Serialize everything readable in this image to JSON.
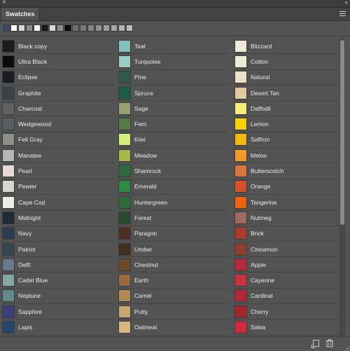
{
  "panel": {
    "tab_label": "Swatches",
    "close_glyph": "×",
    "collapse_glyph": "»"
  },
  "recent_swatches": [
    "#3a4a6a",
    "#ffffff",
    "#d9d9d9",
    "#8c8c8c",
    "#ffffff",
    "#1a1a1a",
    "#d9d9d9",
    "#8c8c8c",
    "#0a0a0a",
    "#6f6f6f",
    "#7a7a7a",
    "#858585",
    "#909090",
    "#9b9b9b",
    "#a6a6a6",
    "#b1b1b1",
    "#bcbcbc"
  ],
  "columns": [
    [
      {
        "name": "Black copy",
        "color": "#1b1b1b"
      },
      {
        "name": "Ultra Black",
        "color": "#0a0a0a"
      },
      {
        "name": "Eclipse",
        "color": "#1a1c20"
      },
      {
        "name": "Graphite",
        "color": "#3b4148"
      },
      {
        "name": "Charcoal",
        "color": "#5e6262"
      },
      {
        "name": "Wedgewood",
        "color": "#545f66"
      },
      {
        "name": "Felt Gray",
        "color": "#8e8e8a"
      },
      {
        "name": "Manatee",
        "color": "#b7b6b9"
      },
      {
        "name": "Pearl",
        "color": "#e6d9d3"
      },
      {
        "name": "Pewter",
        "color": "#d7d6cf"
      },
      {
        "name": "Cape Cod",
        "color": "#eeece3"
      },
      {
        "name": "Midnight",
        "color": "#1d2b36"
      },
      {
        "name": "Navy",
        "color": "#2c3a52"
      },
      {
        "name": "Patriot",
        "color": "#344652"
      },
      {
        "name": "Delft",
        "color": "#687a8a"
      },
      {
        "name": "Cadet Blue",
        "color": "#86a6a4"
      },
      {
        "name": "Neptune",
        "color": "#5e8a8c"
      },
      {
        "name": "Sapphire",
        "color": "#3a3f76"
      },
      {
        "name": "Lapis",
        "color": "#24466a"
      }
    ],
    [
      {
        "name": "Teal",
        "color": "#85bfba"
      },
      {
        "name": "Turquoise",
        "color": "#99cfc4"
      },
      {
        "name": "Pine",
        "color": "#2f5a46"
      },
      {
        "name": "Spruce",
        "color": "#1d5a46"
      },
      {
        "name": "Sage",
        "color": "#96a26f"
      },
      {
        "name": "Fern",
        "color": "#557a46"
      },
      {
        "name": "Kiwi",
        "color": "#d4f07a"
      },
      {
        "name": "Meadow",
        "color": "#a6b64f"
      },
      {
        "name": "Shamrock",
        "color": "#2a6a3e"
      },
      {
        "name": "Emerald",
        "color": "#2e8a3e"
      },
      {
        "name": "Huntergreen",
        "color": "#2f6a3a"
      },
      {
        "name": "Forest",
        "color": "#274a30"
      },
      {
        "name": "Paragon",
        "color": "#4c3026"
      },
      {
        "name": "Umber",
        "color": "#3f2f1e"
      },
      {
        "name": "Chestnut",
        "color": "#6a4a2a"
      },
      {
        "name": "Earth",
        "color": "#9a6a3e"
      },
      {
        "name": "Camel",
        "color": "#b08a54"
      },
      {
        "name": "Putty",
        "color": "#c8a872"
      },
      {
        "name": "Oatmeal",
        "color": "#d8b680"
      }
    ],
    [
      {
        "name": "Blizzard",
        "color": "#eeeadc"
      },
      {
        "name": "Cotton",
        "color": "#f0ebdb"
      },
      {
        "name": "Natural",
        "color": "#ece0c5"
      },
      {
        "name": "Desert Tan",
        "color": "#e0c8a0"
      },
      {
        "name": "Daffodil",
        "color": "#f6ec7a"
      },
      {
        "name": "Lemon",
        "color": "#f7d00e"
      },
      {
        "name": "Saffron",
        "color": "#f5b90e"
      },
      {
        "name": "Melon",
        "color": "#f49a2a"
      },
      {
        "name": "Butterscotch",
        "color": "#d8743e"
      },
      {
        "name": "Orange",
        "color": "#d4522a"
      },
      {
        "name": "Tangerine",
        "color": "#f0620e"
      },
      {
        "name": "Nutmeg",
        "color": "#a06a5e"
      },
      {
        "name": "Brick",
        "color": "#a83a2e"
      },
      {
        "name": "Cinnamon",
        "color": "#8e3e2e"
      },
      {
        "name": "Apple",
        "color": "#b8263a"
      },
      {
        "name": "Cayenne",
        "color": "#c8343e"
      },
      {
        "name": "Cardinal",
        "color": "#b4263a"
      },
      {
        "name": "Cherry",
        "color": "#a6242c"
      },
      {
        "name": "Salsa",
        "color": "#d02a3e"
      }
    ]
  ],
  "icons": {
    "close": "close-icon",
    "collapse": "double-chevron-icon",
    "menu": "hamburger-menu-icon",
    "new_swatch": "new-swatch-icon",
    "delete": "trash-icon"
  }
}
